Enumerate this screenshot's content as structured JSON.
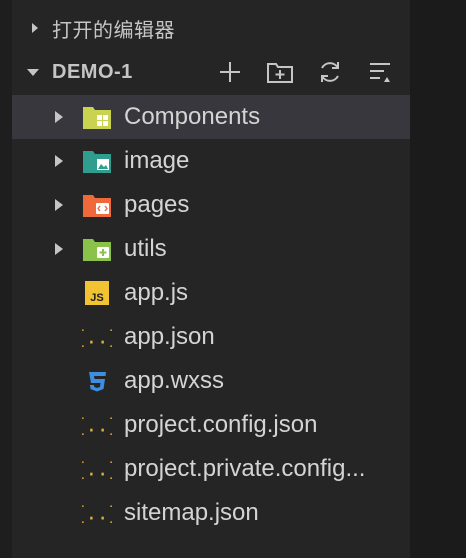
{
  "open_editors": {
    "title": "打开的编辑器"
  },
  "project": {
    "title": "DEMO-1",
    "actions": [
      "new-file-icon",
      "new-folder-icon",
      "refresh-icon",
      "collapse-all-icon"
    ]
  },
  "tree": [
    {
      "label": "Components",
      "kind": "folder",
      "icon": "components-folder-icon",
      "color": "#c9d34f"
    },
    {
      "label": "image",
      "kind": "folder",
      "icon": "image-folder-icon",
      "color": "#2f9e8f"
    },
    {
      "label": "pages",
      "kind": "folder",
      "icon": "pages-folder-icon",
      "color": "#f0693b"
    },
    {
      "label": "utils",
      "kind": "folder",
      "icon": "utils-folder-icon",
      "color": "#8bc34a"
    },
    {
      "label": "app.js",
      "kind": "file",
      "icon": "js-file-icon",
      "color": "#f1c232"
    },
    {
      "label": "app.json",
      "kind": "file",
      "icon": "json-file-icon",
      "color": "#e8b538"
    },
    {
      "label": "app.wxss",
      "kind": "file",
      "icon": "css-file-icon",
      "color": "#3d8ee0"
    },
    {
      "label": "project.config.json",
      "kind": "file",
      "icon": "json-file-icon",
      "color": "#e8b538"
    },
    {
      "label": "project.private.config...",
      "kind": "file",
      "icon": "json-file-icon",
      "color": "#e8b538"
    },
    {
      "label": "sitemap.json",
      "kind": "file",
      "icon": "json-file-icon",
      "color": "#e8b538"
    }
  ]
}
